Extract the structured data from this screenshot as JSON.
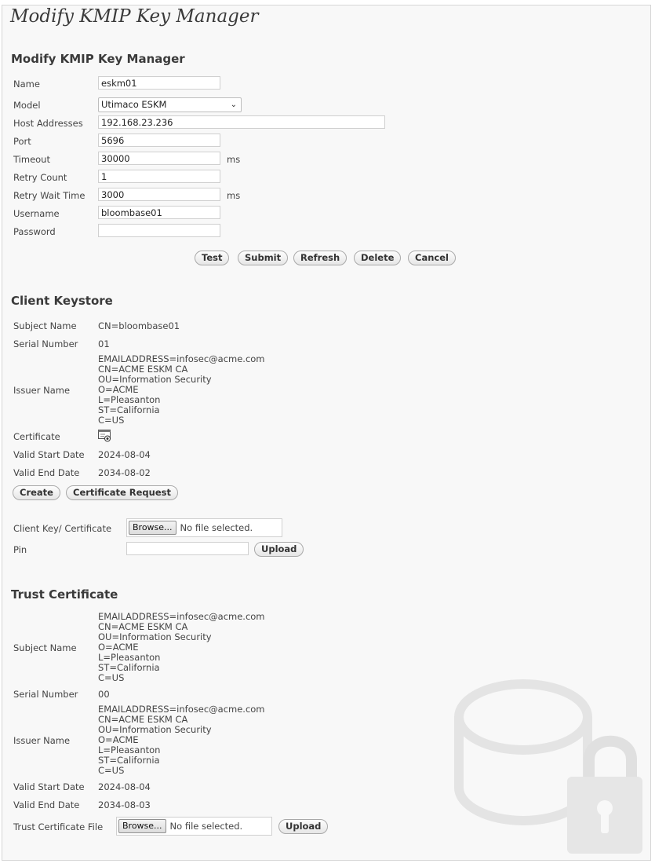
{
  "page": {
    "title": "Modify KMIP Key Manager"
  },
  "manager": {
    "heading": "Modify KMIP Key Manager",
    "fields": {
      "name": {
        "label": "Name",
        "value": "eskm01"
      },
      "model": {
        "label": "Model",
        "value": "Utimaco ESKM"
      },
      "host": {
        "label": "Host Addresses",
        "value": "192.168.23.236"
      },
      "port": {
        "label": "Port",
        "value": "5696"
      },
      "timeout": {
        "label": "Timeout",
        "value": "30000",
        "unit": "ms"
      },
      "retry_count": {
        "label": "Retry Count",
        "value": "1"
      },
      "retry_wait": {
        "label": "Retry Wait Time",
        "value": "3000",
        "unit": "ms"
      },
      "username": {
        "label": "Username",
        "value": "bloombase01"
      },
      "password": {
        "label": "Password",
        "value": ""
      }
    },
    "buttons": {
      "test": "Test",
      "submit": "Submit",
      "refresh": "Refresh",
      "delete": "Delete",
      "cancel": "Cancel"
    }
  },
  "client_keystore": {
    "heading": "Client Keystore",
    "subject_name": {
      "label": "Subject Name",
      "value": "CN=bloombase01"
    },
    "serial_number": {
      "label": "Serial Number",
      "value": "01"
    },
    "issuer_name": {
      "label": "Issuer Name",
      "lines": [
        "EMAILADDRESS=infosec@acme.com",
        "CN=ACME ESKM CA",
        "OU=Information Security",
        "O=ACME",
        "L=Pleasanton",
        "ST=California",
        "C=US"
      ]
    },
    "certificate": {
      "label": "Certificate",
      "icon": "certificate-icon"
    },
    "valid_start": {
      "label": "Valid Start Date",
      "value": "2024-08-04"
    },
    "valid_end": {
      "label": "Valid End Date",
      "value": "2034-08-02"
    },
    "buttons": {
      "create": "Create",
      "cert_request": "Certificate Request"
    },
    "upload": {
      "file_label": "Client Key/ Certificate",
      "browse": "Browse...",
      "no_file": "No file selected.",
      "pin_label": "Pin",
      "pin_value": "",
      "upload_button": "Upload"
    }
  },
  "trust_certificate": {
    "heading": "Trust Certificate",
    "subject_name": {
      "label": "Subject Name",
      "lines": [
        "EMAILADDRESS=infosec@acme.com",
        "CN=ACME ESKM CA",
        "OU=Information Security",
        "O=ACME",
        "L=Pleasanton",
        "ST=California",
        "C=US"
      ]
    },
    "serial_number": {
      "label": "Serial Number",
      "value": "00"
    },
    "issuer_name": {
      "label": "Issuer Name",
      "lines": [
        "EMAILADDRESS=infosec@acme.com",
        "CN=ACME ESKM CA",
        "OU=Information Security",
        "O=ACME",
        "L=Pleasanton",
        "ST=California",
        "C=US"
      ]
    },
    "valid_start": {
      "label": "Valid Start Date",
      "value": "2024-08-04"
    },
    "valid_end": {
      "label": "Valid End Date",
      "value": "2034-08-03"
    },
    "upload": {
      "file_label": "Trust Certificate File",
      "browse": "Browse...",
      "no_file": "No file selected.",
      "upload_button": "Upload"
    }
  },
  "watermark": {
    "icon": "encrypted-storage-icon"
  },
  "colors": {
    "page_bg": "#f8f8f8",
    "heading": "#3a3a3a",
    "watermark": "#e6e6e6"
  }
}
